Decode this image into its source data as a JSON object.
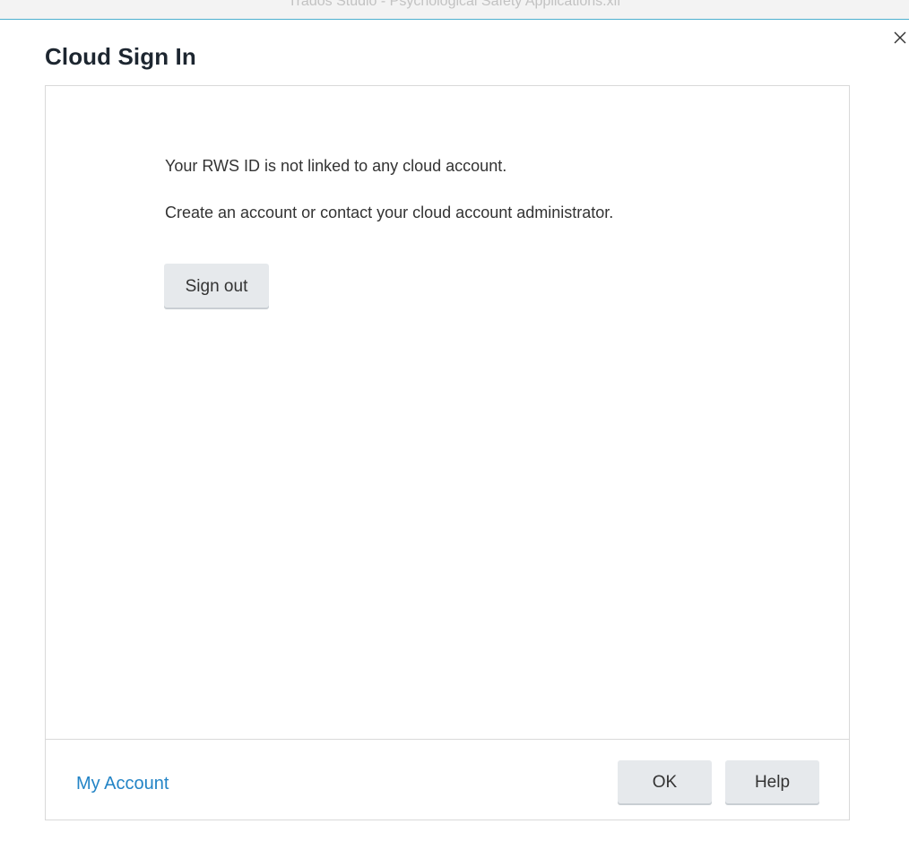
{
  "window": {
    "title": "Trados Studio - Psychological Safety Applications.xlf"
  },
  "dialog": {
    "title": "Cloud Sign In",
    "close_icon": "close-icon"
  },
  "content": {
    "message_line1": "Your RWS ID is not linked to any cloud account.",
    "message_line2": "Create an account or contact your cloud account administrator.",
    "sign_out_label": "Sign out"
  },
  "footer": {
    "my_account_label": "My Account",
    "ok_label": "OK",
    "help_label": "Help"
  },
  "colors": {
    "accent_line": "#4db0cf",
    "link": "#2384c6",
    "button_bg": "#e6e9ec",
    "title_text": "#1d2630"
  }
}
